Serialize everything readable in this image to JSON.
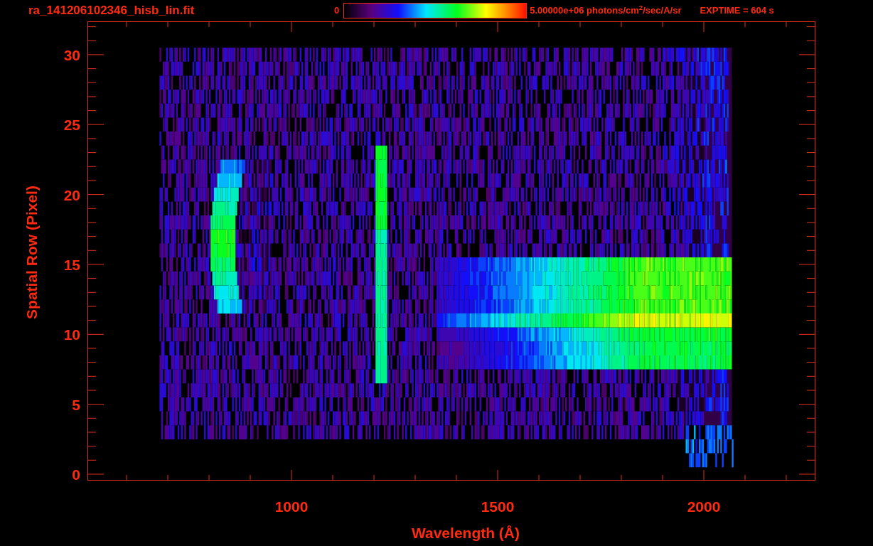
{
  "header": {
    "title": "ra_141206102346_hisb_lin.fit",
    "colorbar_min": "0",
    "colorbar_max": "5.00000e+06 photons/cm$^{2}$/sec/A/sr",
    "exposure": "EXPTIME = 604 s"
  },
  "plot": {
    "xlabel": "Wavelength (Å)",
    "ylabel": "Spatial Row (Pixel)",
    "xticks": [
      "1000",
      "1500",
      "2000"
    ],
    "yticks": [
      "30",
      "25",
      "20",
      "15",
      "10",
      "5",
      "0"
    ]
  }
}
